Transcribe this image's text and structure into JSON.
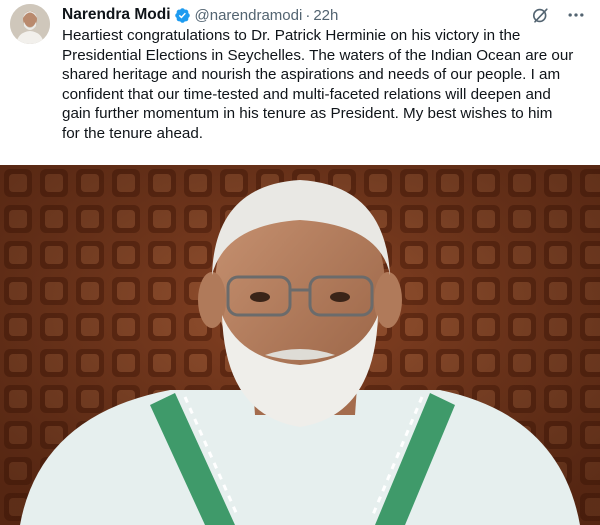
{
  "tweet": {
    "author_name": "Narendra Modi",
    "handle": "@narendramodi",
    "separator": "·",
    "timestamp": "22h",
    "text": "Heartiest congratulations to Dr. Patrick Herminie on his victory in the\nPresidential Elections in Seychelles. The waters of the Indian Ocean are our\nshared heritage and nourish the aspirations and needs of our people. I am\nconfident that our time-tested and multi-faceted relations will deepen and\ngain further momentum in his tenure as President. My best wishes to him\nfor the tenure ahead.",
    "verified": true,
    "icons": {
      "avatar": "profile-avatar",
      "verified": "verified-badge-icon",
      "grok": "grok-icon",
      "more": "more-options-icon"
    }
  },
  "colors": {
    "text": "#0f1419",
    "secondary": "#536471",
    "verified": "#1d9bf0",
    "photo_background": "#7a3a1e"
  }
}
